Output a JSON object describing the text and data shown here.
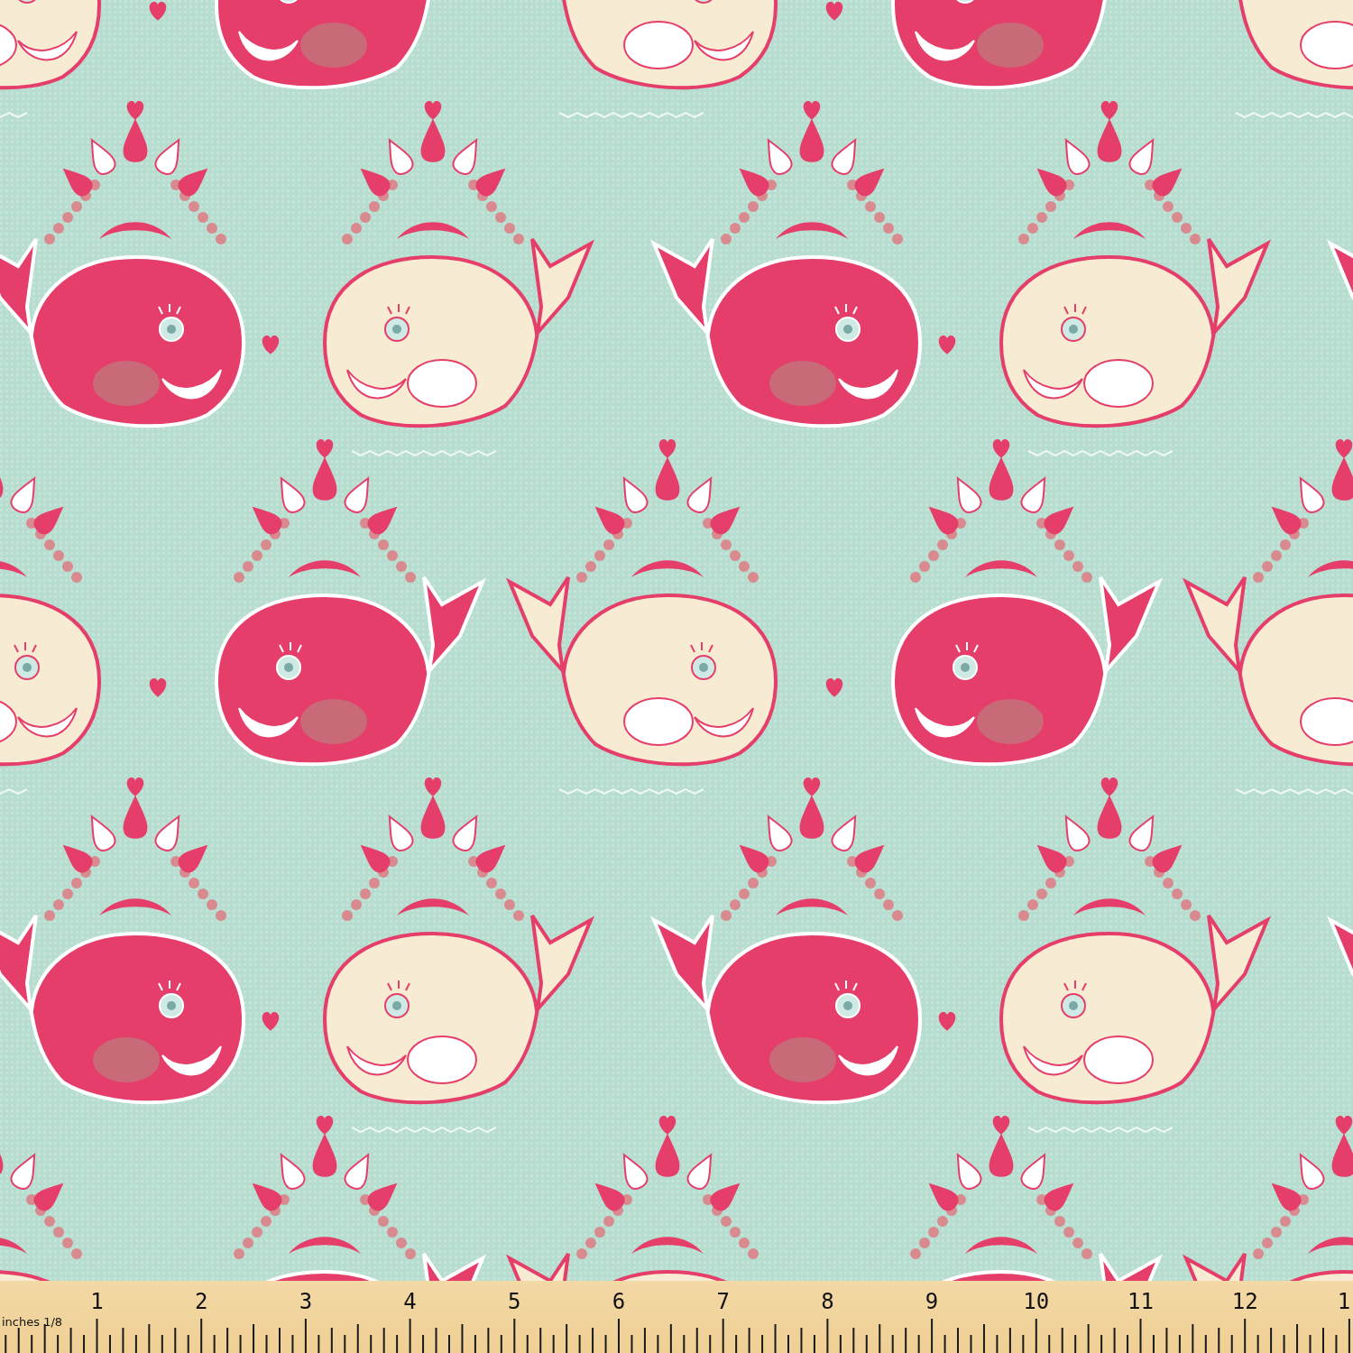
{
  "ruler": {
    "label": "inches 1/8",
    "numbers": [
      "1",
      "2",
      "3",
      "4",
      "5",
      "6",
      "7",
      "8",
      "9",
      "10",
      "11",
      "12",
      "1"
    ]
  }
}
